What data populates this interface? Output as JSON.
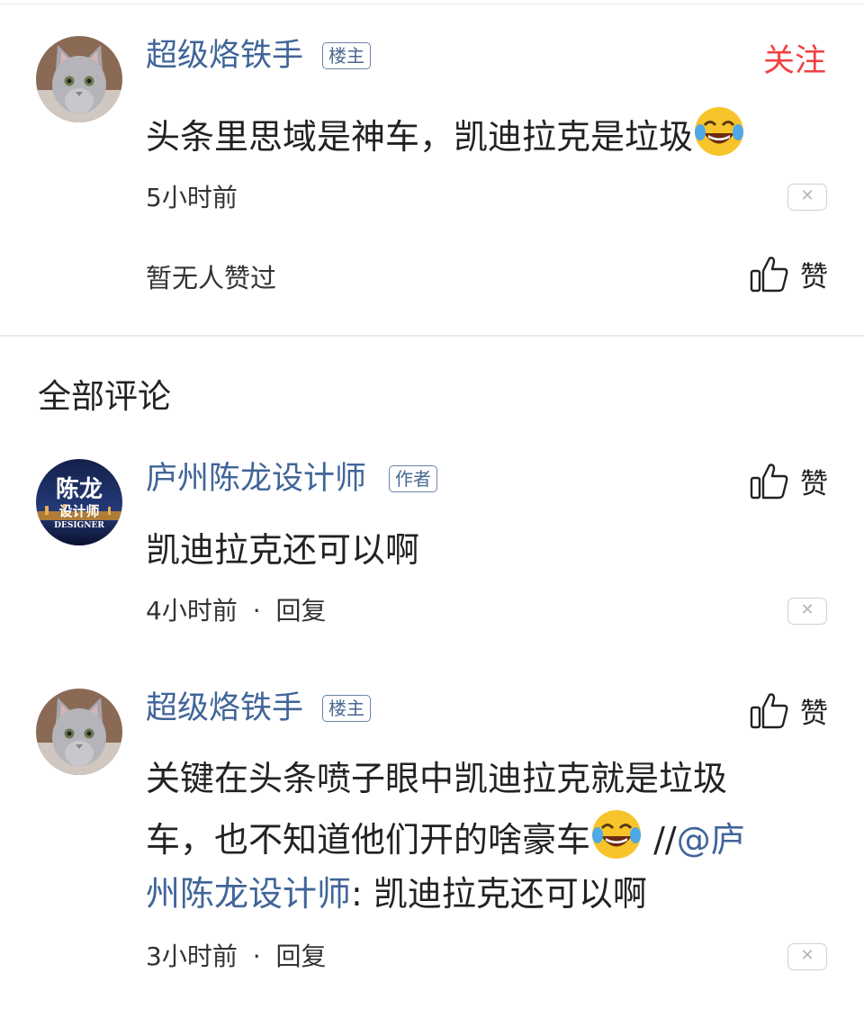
{
  "top_comment": {
    "username": "超级烙铁手",
    "badge": "楼主",
    "follow_label": "关注",
    "text": "头条里思域是神车，凯迪拉克是垃圾",
    "emoji": "crying-laughing-emoji",
    "time": "5小时前",
    "no_likes_text": "暂无人赞过",
    "like_label": "赞"
  },
  "section_title": "全部评论",
  "replies": [
    {
      "username": "庐州陈龙设计师",
      "badge": "作者",
      "avatar_text_line1": "陈龙",
      "avatar_text_line2": "设计师",
      "avatar_text_line3": "DESIGNER",
      "like_label": "赞",
      "text": "凯迪拉克还可以啊",
      "time": "4小时前",
      "reply_label": "回复"
    },
    {
      "username": "超级烙铁手",
      "badge": "楼主",
      "like_label": "赞",
      "text_line1": "关键在头条喷子眼中凯迪拉克就是垃圾",
      "text_line2_pre": "车，也不知道他们开的啥豪车",
      "text_line2_sep": " //",
      "text_line2_mention": "@庐",
      "text_line3_mention": "州陈龙设计师",
      "text_line3_post": ": 凯迪拉克还可以啊",
      "time": "3小时前",
      "reply_label": "回复"
    }
  ],
  "meta_separator": "·",
  "close_glyph": "✕",
  "colors": {
    "username_blue": "#406599",
    "follow_red": "#f04142",
    "divider": "#e8e8e8"
  }
}
